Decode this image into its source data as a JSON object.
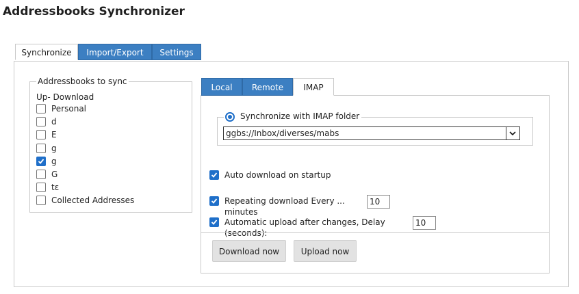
{
  "app": {
    "title": "Addressbooks Synchronizer"
  },
  "main_tabs": [
    {
      "label": "Synchronize",
      "active": true
    },
    {
      "label": "Import/Export",
      "active": false
    },
    {
      "label": "Settings",
      "active": false
    }
  ],
  "addressbooks": {
    "legend": "Addressbooks to sync",
    "header": "Up- Download",
    "items": [
      {
        "label": "Personal",
        "checked": false
      },
      {
        "label": "d",
        "checked": false
      },
      {
        "label": "E",
        "checked": false
      },
      {
        "label": "g",
        "checked": false
      },
      {
        "label": "g",
        "checked": true
      },
      {
        "label": "G",
        "checked": false
      },
      {
        "label": "tɛ",
        "checked": false
      },
      {
        "label": "Collected Addresses",
        "checked": false
      }
    ]
  },
  "sub_tabs": [
    {
      "label": "Local",
      "active": false
    },
    {
      "label": "Remote",
      "active": false
    },
    {
      "label": "IMAP",
      "active": true
    }
  ],
  "imap": {
    "radio_label": "Synchronize with IMAP folder",
    "folder_value": "ggbs://Inbox/diverses/mabs",
    "auto_download_label": "Auto download on startup",
    "auto_download_checked": true,
    "repeat_label": "Repeating download Every ... minutes",
    "repeat_checked": true,
    "repeat_value": "10",
    "auto_upload_label": "Automatic upload after changes, Delay (seconds):",
    "auto_upload_checked": true,
    "auto_upload_value": "10"
  },
  "buttons": {
    "download_now": "Download now",
    "upload_now": "Upload now"
  },
  "colors": {
    "accent": "#3c7fc2",
    "check": "#1f6fc9"
  }
}
